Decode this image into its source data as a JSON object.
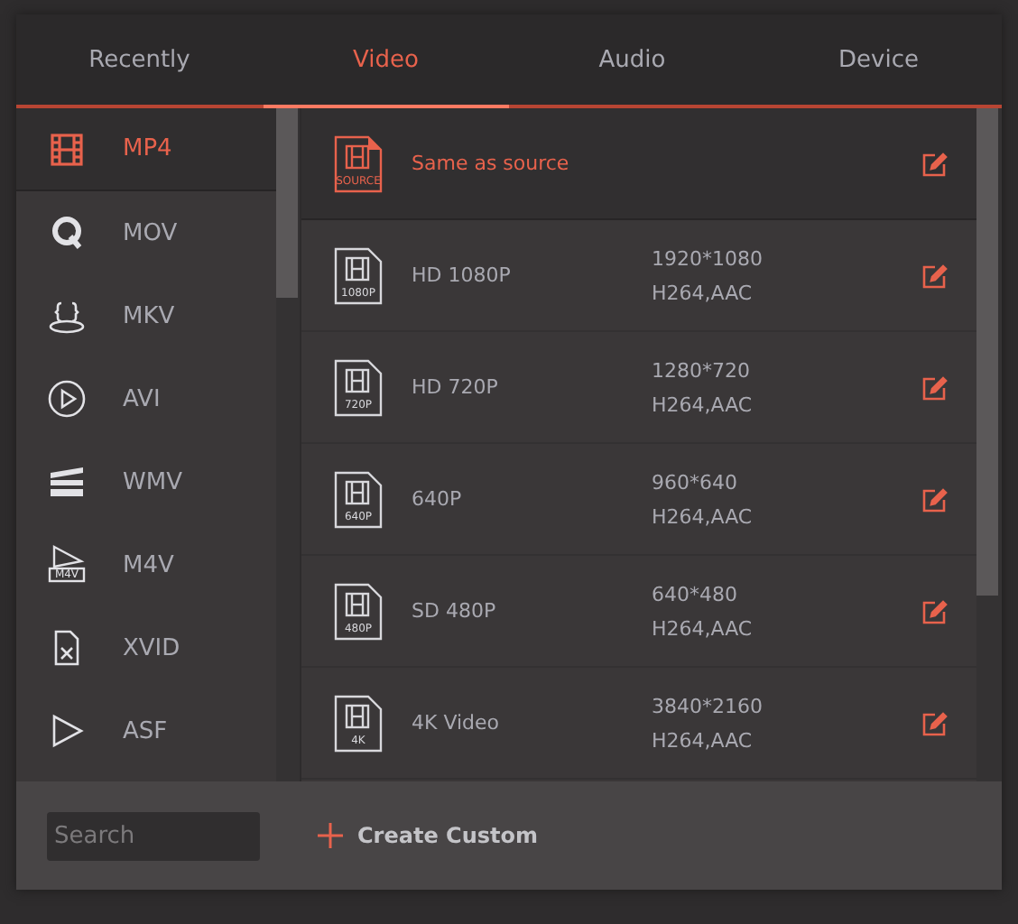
{
  "tabs": [
    {
      "label": "Recently",
      "selected": false
    },
    {
      "label": "Video",
      "selected": true
    },
    {
      "label": "Audio",
      "selected": false
    },
    {
      "label": "Device",
      "selected": false
    }
  ],
  "formats": [
    {
      "label": "MP4",
      "kind": "film",
      "selected": true
    },
    {
      "label": "MOV",
      "kind": "q",
      "selected": false
    },
    {
      "label": "MKV",
      "kind": "braces",
      "selected": false
    },
    {
      "label": "AVI",
      "kind": "circle",
      "selected": false
    },
    {
      "label": "WMV",
      "kind": "clapper",
      "selected": false
    },
    {
      "label": "M4V",
      "kind": "tagged",
      "icon_text": "M4V",
      "selected": false
    },
    {
      "label": "XVID",
      "kind": "file",
      "selected": false
    },
    {
      "label": "ASF",
      "kind": "play",
      "selected": false
    }
  ],
  "presets": [
    {
      "kind": "source",
      "name": "Same as source",
      "badge": "SOURCE",
      "selected": true
    },
    {
      "kind": "preset",
      "name": "HD 1080P",
      "badge": "1080P",
      "selected": false,
      "resolution": "1920*1080",
      "codec": "H264,AAC"
    },
    {
      "kind": "preset",
      "name": "HD 720P",
      "badge": "720P",
      "selected": false,
      "resolution": "1280*720",
      "codec": "H264,AAC"
    },
    {
      "kind": "preset",
      "name": "640P",
      "badge": "640P",
      "selected": false,
      "resolution": "960*640",
      "codec": "H264,AAC"
    },
    {
      "kind": "preset",
      "name": "SD 480P",
      "badge": "480P",
      "selected": false,
      "resolution": "640*480",
      "codec": "H264,AAC"
    },
    {
      "kind": "preset",
      "name": "4K Video",
      "badge": "4K",
      "selected": false,
      "resolution": "3840*2160",
      "codec": "H264,AAC"
    }
  ],
  "search": {
    "placeholder": "Search"
  },
  "create_button": {
    "label": "Create Custom"
  }
}
